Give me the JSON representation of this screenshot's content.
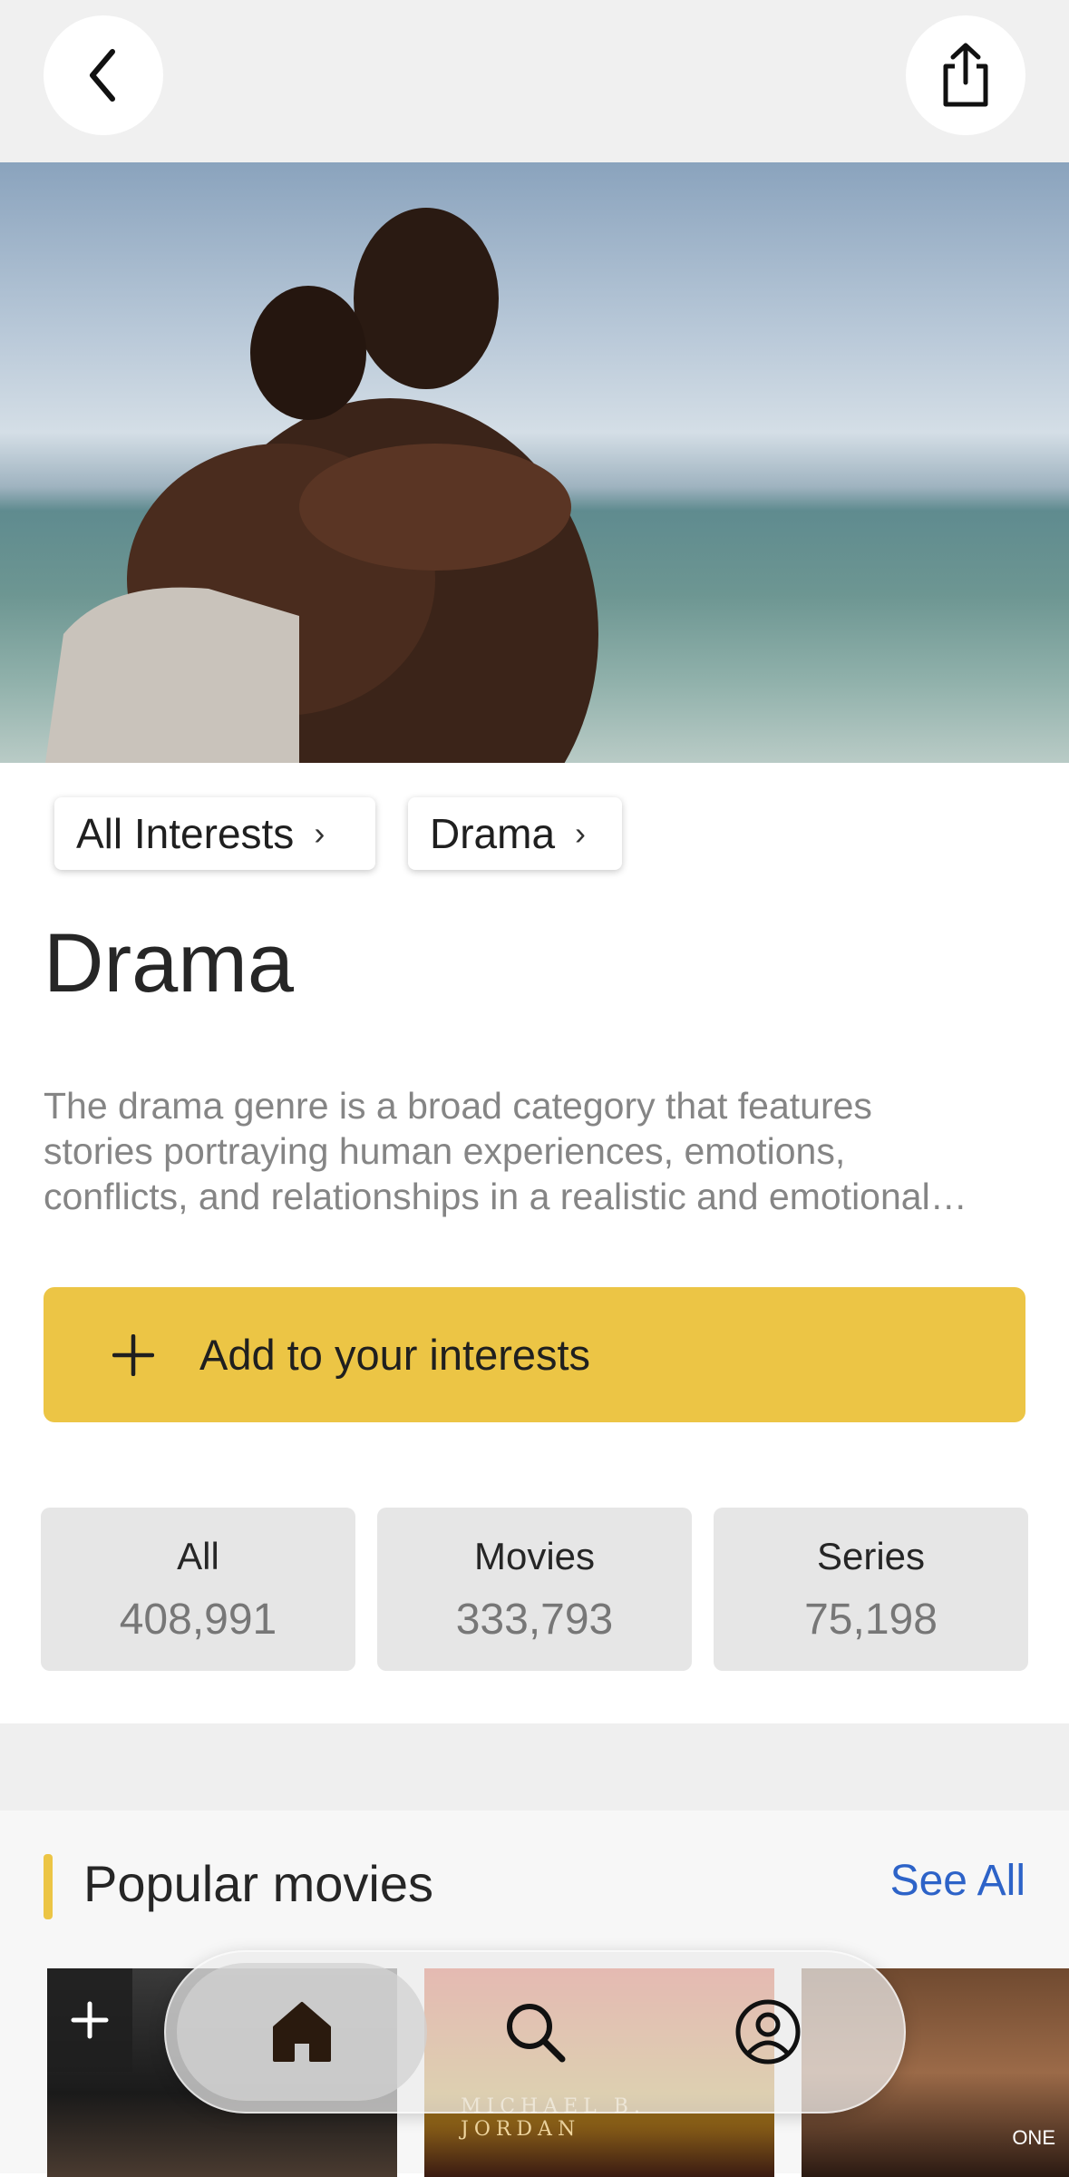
{
  "header": {
    "back_icon": "chevron-left-icon",
    "share_icon": "share-icon"
  },
  "breadcrumbs": [
    {
      "label": "All Interests"
    },
    {
      "label": "Drama"
    }
  ],
  "page": {
    "title": "Drama",
    "description_lines": [
      "The drama genre is a broad category that features",
      "stories portraying human experiences, emotions,",
      "conflicts, and relationships in a realistic and emotional…"
    ]
  },
  "add_button": {
    "label": "Add to your interests",
    "icon": "plus-icon",
    "color": "#ecc545"
  },
  "stats": [
    {
      "label": "All",
      "value": "408,991"
    },
    {
      "label": "Movies",
      "value": "333,793"
    },
    {
      "label": "Series",
      "value": "75,198"
    }
  ],
  "section": {
    "title": "Popular movies",
    "see_all": "See All",
    "accent": "#ecc545",
    "link_color": "#2d63c8"
  },
  "posters": [
    {
      "caption": ""
    },
    {
      "caption": "MICHAEL B. JORDAN"
    },
    {
      "caption": "ONE"
    }
  ],
  "bottom_nav": {
    "items": [
      {
        "icon": "home-icon",
        "active": true
      },
      {
        "icon": "search-icon",
        "active": false
      },
      {
        "icon": "profile-icon",
        "active": false
      }
    ]
  }
}
